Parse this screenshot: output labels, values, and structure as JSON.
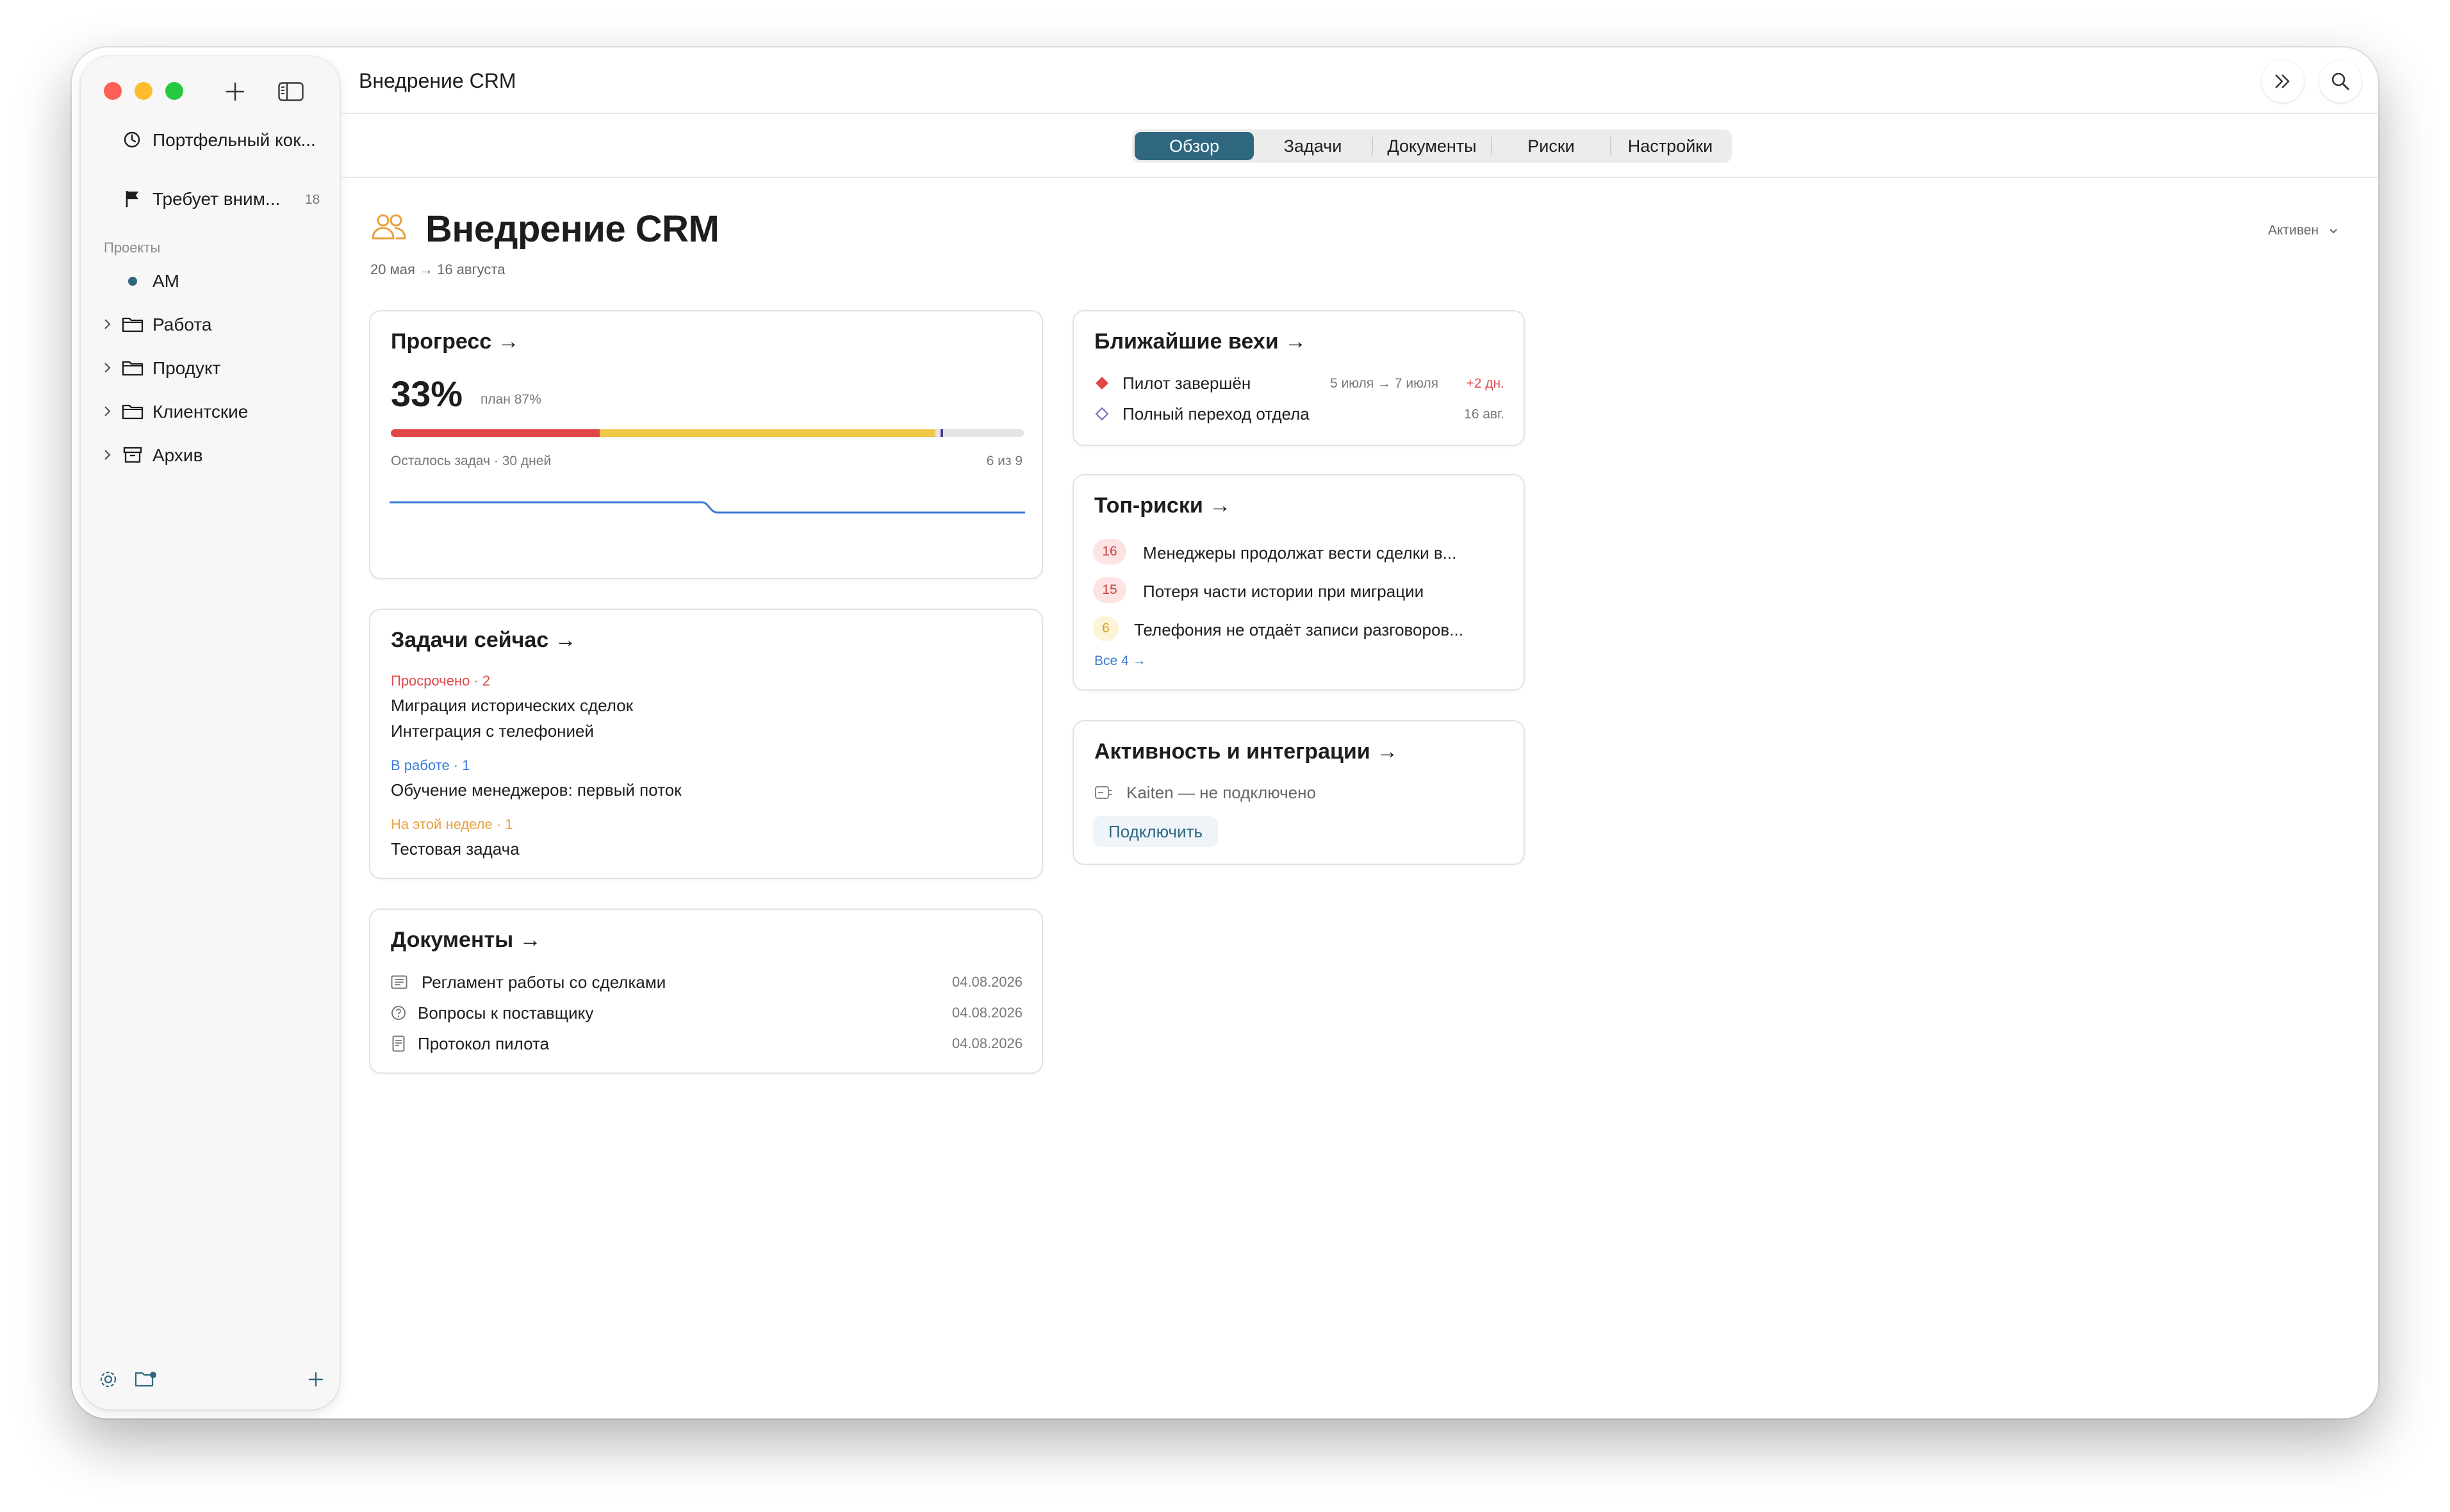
{
  "window": {
    "title": "Внедрение CRM"
  },
  "sidebar": {
    "top_items": [
      {
        "label": "Портфельный кок...",
        "icon": "clock-icon"
      },
      {
        "label": "Требует вним...",
        "icon": "flag-icon",
        "count": "18"
      }
    ],
    "section_label": "Проекты",
    "projects": [
      {
        "label": "AM",
        "icon": "dot-icon"
      },
      {
        "label": "Работа",
        "icon": "folder-icon"
      },
      {
        "label": "Продукт",
        "icon": "folder-icon"
      },
      {
        "label": "Клиентские",
        "icon": "folder-icon"
      },
      {
        "label": "Архив",
        "icon": "archive-icon"
      }
    ]
  },
  "tabs": [
    {
      "label": "Обзор",
      "active": true
    },
    {
      "label": "Задачи",
      "active": false
    },
    {
      "label": "Документы",
      "active": false
    },
    {
      "label": "Риски",
      "active": false
    },
    {
      "label": "Настройки",
      "active": false
    }
  ],
  "project": {
    "title": "Внедрение CRM",
    "dates": "20 мая → 16 августа",
    "status": "Активен"
  },
  "progress": {
    "title": "Прогресс →",
    "percent": "33%",
    "plan": "план 87%",
    "segments": {
      "done": 0.33,
      "in_progress": 0.53,
      "plan_marker": 0.87
    },
    "remaining": "Осталось задач · 30 дней",
    "count": "6 из 9"
  },
  "tasks_now": {
    "title": "Задачи сейчас →",
    "groups": [
      {
        "label": "Просрочено · 2",
        "items": [
          "Миграция исторических сделок",
          "Интеграция с телефонией"
        ]
      },
      {
        "label": "В работе · 1",
        "items": [
          "Обучение менеджеров: первый поток"
        ]
      },
      {
        "label": "На этой неделе · 1",
        "items": [
          "Тестовая задача"
        ]
      }
    ]
  },
  "documents": {
    "title": "Документы →",
    "items": [
      {
        "name": "Регламент работы со сделками",
        "date": "04.08.2026",
        "icon": "document-icon"
      },
      {
        "name": "Вопросы к поставщику",
        "date": "04.08.2026",
        "icon": "question-icon"
      },
      {
        "name": "Протокол пилота",
        "date": "04.08.2026",
        "icon": "page-icon"
      }
    ]
  },
  "milestones": {
    "title": "Ближайшие вехи →",
    "items": [
      {
        "name": "Пилот завершён",
        "dates": "5 июля → 7 июля",
        "delay": "+2 дн."
      },
      {
        "name": "Полный переход отдела",
        "dates": "16 авг.",
        "delay": ""
      }
    ]
  },
  "risks": {
    "title": "Топ-риски →",
    "items": [
      {
        "score": "16",
        "text": "Менеджеры продолжат вести сделки в..."
      },
      {
        "score": "15",
        "text": "Потеря части истории при миграции"
      },
      {
        "score": "6",
        "text": "Телефония не отдаёт записи разговоров..."
      }
    ],
    "all_link": "Все 4 →"
  },
  "activity": {
    "title": "Активность и интеграции →",
    "integration": "Kaiten — не подключено",
    "connect": "Подключить"
  },
  "colors": {
    "accent": "#2f6781",
    "red": "#e04848",
    "yellow": "#f0c84a",
    "blue": "#3a7bd5",
    "orange": "#e8a040"
  }
}
